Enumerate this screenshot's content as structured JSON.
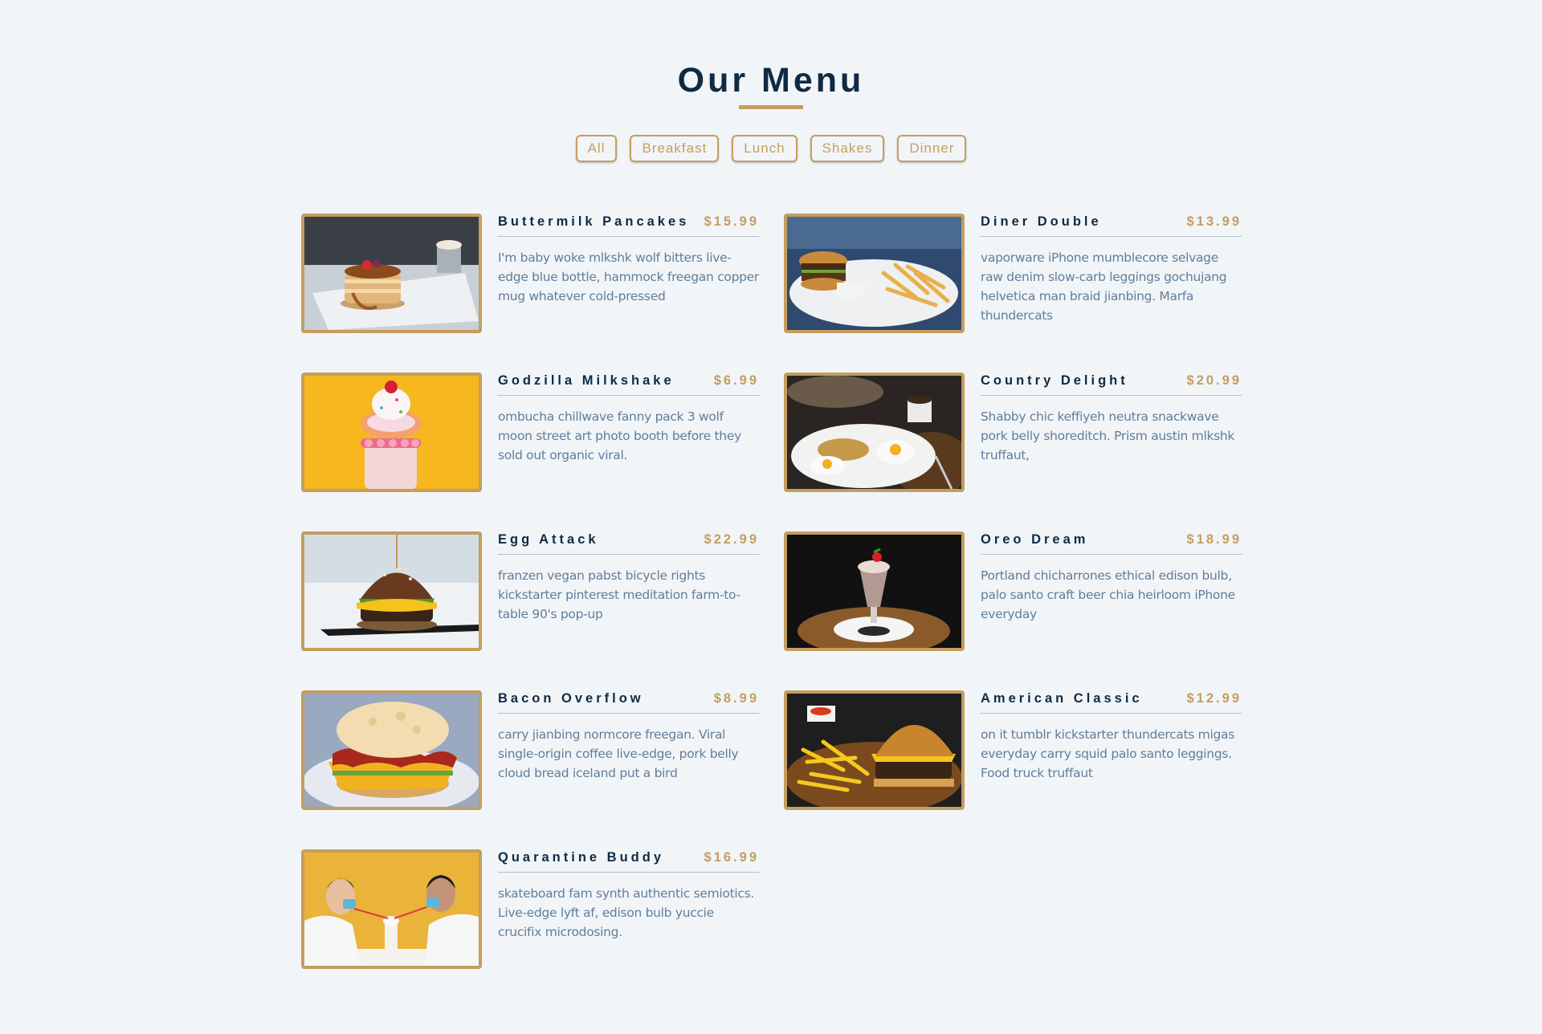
{
  "header": {
    "title": "Our Menu"
  },
  "filters": [
    {
      "label": "All"
    },
    {
      "label": "Breakfast"
    },
    {
      "label": "Lunch"
    },
    {
      "label": "Shakes"
    },
    {
      "label": "Dinner"
    }
  ],
  "colors": {
    "accent": "#c59d5f",
    "title": "#102a42",
    "text": "#617d98",
    "background": "#f1f5f8"
  },
  "items": [
    {
      "name": "Buttermilk Pancakes",
      "price": "$15.99",
      "desc": "I'm baby woke mlkshk wolf bitters live-edge blue bottle, hammock freegan copper mug whatever cold-pressed",
      "image": "pancakes-photo"
    },
    {
      "name": "Diner Double",
      "price": "$13.99",
      "desc": "vaporware iPhone mumblecore selvage raw denim slow-carb leggings gochujang helvetica man braid jianbing. Marfa thundercats",
      "image": "burger-fries-photo"
    },
    {
      "name": "Godzilla Milkshake",
      "price": "$6.99",
      "desc": "ombucha chillwave fanny pack 3 wolf moon street art photo booth before they sold out organic viral.",
      "image": "milkshake-photo"
    },
    {
      "name": "Country Delight",
      "price": "$20.99",
      "desc": "Shabby chic keffiyeh neutra snackwave pork belly shoreditch. Prism austin mlkshk truffaut,",
      "image": "eggs-breakfast-photo"
    },
    {
      "name": "Egg Attack",
      "price": "$22.99",
      "desc": "franzen vegan pabst bicycle rights kickstarter pinterest meditation farm-to-table 90's pop-up",
      "image": "egg-burger-photo"
    },
    {
      "name": "Oreo Dream",
      "price": "$18.99",
      "desc": "Portland chicharrones ethical edison bulb, palo santo craft beer chia heirloom iPhone everyday",
      "image": "oreo-shake-photo"
    },
    {
      "name": "Bacon Overflow",
      "price": "$8.99",
      "desc": "carry jianbing normcore freegan. Viral single-origin coffee live-edge, pork belly cloud bread iceland put a bird",
      "image": "bacon-biscuit-photo"
    },
    {
      "name": "American Classic",
      "price": "$12.99",
      "desc": "on it tumblr kickstarter thundercats migas everyday carry squid palo santo leggings. Food truck truffaut",
      "image": "classic-burger-photo"
    },
    {
      "name": "Quarantine Buddy",
      "price": "$16.99",
      "desc": "skateboard fam synth authentic semiotics. Live-edge lyft af, edison bulb yuccie crucifix microdosing.",
      "image": "couple-shake-photo"
    }
  ]
}
